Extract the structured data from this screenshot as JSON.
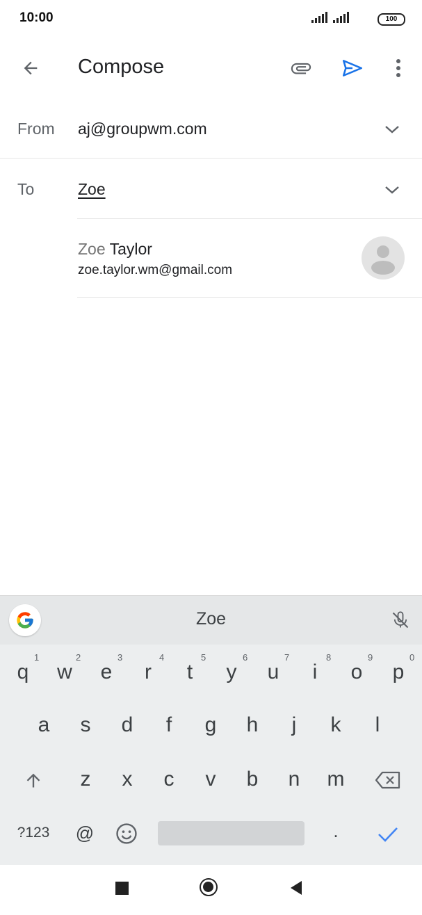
{
  "status_bar": {
    "time": "10:00",
    "battery": "100"
  },
  "app_bar": {
    "title": "Compose",
    "icons": [
      "back-arrow-icon",
      "attach-icon",
      "send-icon",
      "more-vert-icon"
    ],
    "send_color": "#1a73e8"
  },
  "from_field": {
    "label": "From",
    "value": "aj@groupwm.com"
  },
  "to_field": {
    "label": "To",
    "value": "Zoe"
  },
  "contact_suggestion": {
    "name_match": "Zoe",
    "name_rest": " Taylor",
    "email": "zoe.taylor.wm@gmail.com"
  },
  "keyboard": {
    "suggestion": "Zoe",
    "row1": [
      {
        "key": "q",
        "hint": "1"
      },
      {
        "key": "w",
        "hint": "2"
      },
      {
        "key": "e",
        "hint": "3"
      },
      {
        "key": "r",
        "hint": "4"
      },
      {
        "key": "t",
        "hint": "5"
      },
      {
        "key": "y",
        "hint": "6"
      },
      {
        "key": "u",
        "hint": "7"
      },
      {
        "key": "i",
        "hint": "8"
      },
      {
        "key": "o",
        "hint": "9"
      },
      {
        "key": "p",
        "hint": "0"
      }
    ],
    "row2": [
      "a",
      "s",
      "d",
      "f",
      "g",
      "h",
      "j",
      "k",
      "l"
    ],
    "row3": [
      "z",
      "x",
      "c",
      "v",
      "b",
      "n",
      "m"
    ],
    "symbols_key": "?123",
    "at_key": "@",
    "period_key": ".",
    "check_color": "#4285f4"
  }
}
